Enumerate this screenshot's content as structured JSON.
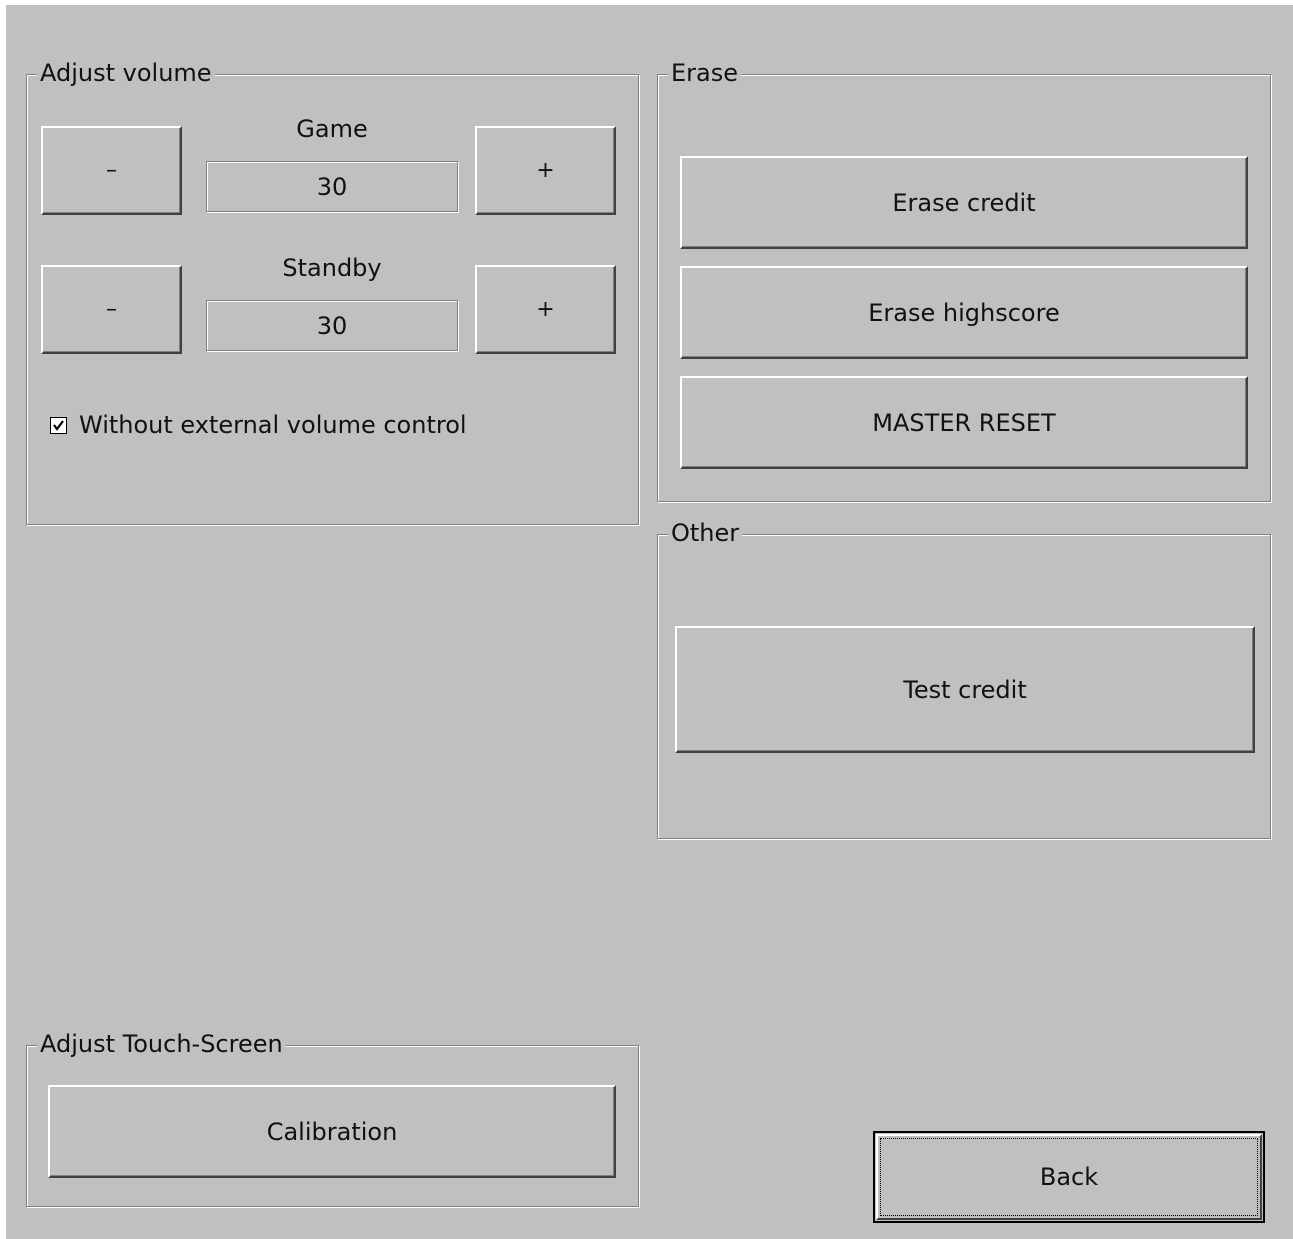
{
  "volume": {
    "title": "Adjust volume",
    "game": {
      "label": "Game",
      "value": "30",
      "decrease": "–",
      "increase": "+"
    },
    "standby": {
      "label": "Standby",
      "value": "30",
      "decrease": "–",
      "increase": "+"
    },
    "external_control": {
      "label": "Without external volume control",
      "checked": true
    }
  },
  "erase": {
    "title": "Erase",
    "erase_credit": "Erase credit",
    "erase_highscore": "Erase highscore",
    "master_reset": "MASTER RESET"
  },
  "other": {
    "title": "Other",
    "test_credit": "Test credit"
  },
  "touch": {
    "title": "Adjust Touch-Screen",
    "calibration": "Calibration"
  },
  "back": "Back",
  "colors": {
    "background": "#c0c0c0"
  }
}
